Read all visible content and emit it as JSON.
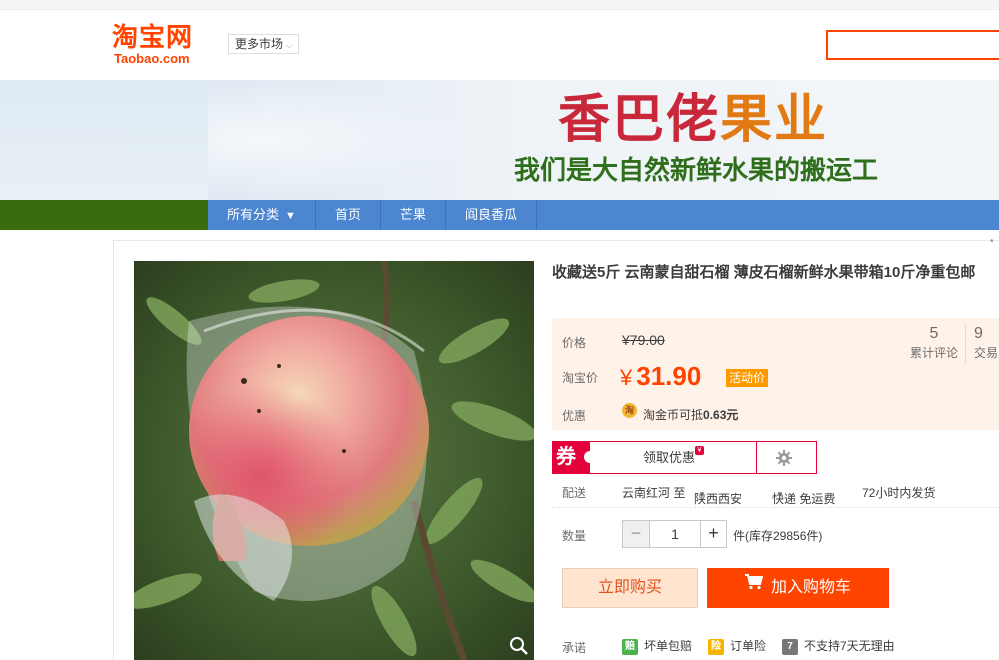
{
  "header": {
    "logo_cn": "淘宝网",
    "logo_en": "Taobao.com",
    "more_markets": "更多市场",
    "search_placeholder": ""
  },
  "banner": {
    "brand_part1": "香巴佬",
    "brand_part2": "果业",
    "slogan": "我们是大自然新鲜水果的搬运工"
  },
  "nav": {
    "items": [
      {
        "label": "所有分类",
        "icon": "triangle-down-icon"
      },
      {
        "label": "首页"
      },
      {
        "label": "芒果"
      },
      {
        "label": "阎良香瓜"
      }
    ]
  },
  "product": {
    "title": "收藏送5斤 云南蒙自甜石榴 薄皮石榴新鲜水果带箱10斤净重包邮",
    "image_alt": "石榴"
  },
  "price": {
    "orig_label": "价格",
    "orig_value": "¥79.00",
    "tb_label": "淘宝价",
    "currency": "¥",
    "tb_value": "31.90",
    "promo_tag": "活动价",
    "discount_label": "优惠",
    "coin_icon_char": "淘",
    "coin_text_prefix": "淘金币可抵",
    "coin_amount": "0.63元",
    "stats": [
      {
        "num": "5",
        "label": "累计评论"
      },
      {
        "num": "9",
        "label": "交易"
      }
    ]
  },
  "coupon": {
    "badge": "券",
    "link": "领取优惠",
    "dot": "¥"
  },
  "shipping": {
    "label": "配送",
    "from": "云南红河 至",
    "to": "陕西西安",
    "method": "快递 免运费",
    "dispatch": "72小时内发货"
  },
  "quantity": {
    "label": "数量",
    "value": "1",
    "minus": "−",
    "plus": "+",
    "stock": "件(库存29856件)"
  },
  "actions": {
    "buy_now": "立即购买",
    "add_cart": "加入购物车"
  },
  "promise": {
    "label": "承诺",
    "items": [
      {
        "icon_char": "赔",
        "text": "坏单包赔",
        "color": "#4cb24c"
      },
      {
        "icon_char": "险",
        "text": "订单险",
        "color": "#f5b400"
      },
      {
        "icon_char": "7",
        "text": "不支持7天无理由",
        "color": "#777777"
      }
    ]
  },
  "colors": {
    "taobao_orange": "#ff4400",
    "nav_blue": "#4c86d1",
    "nav_green": "#3a6b0f",
    "coupon_red": "#e4003b"
  }
}
